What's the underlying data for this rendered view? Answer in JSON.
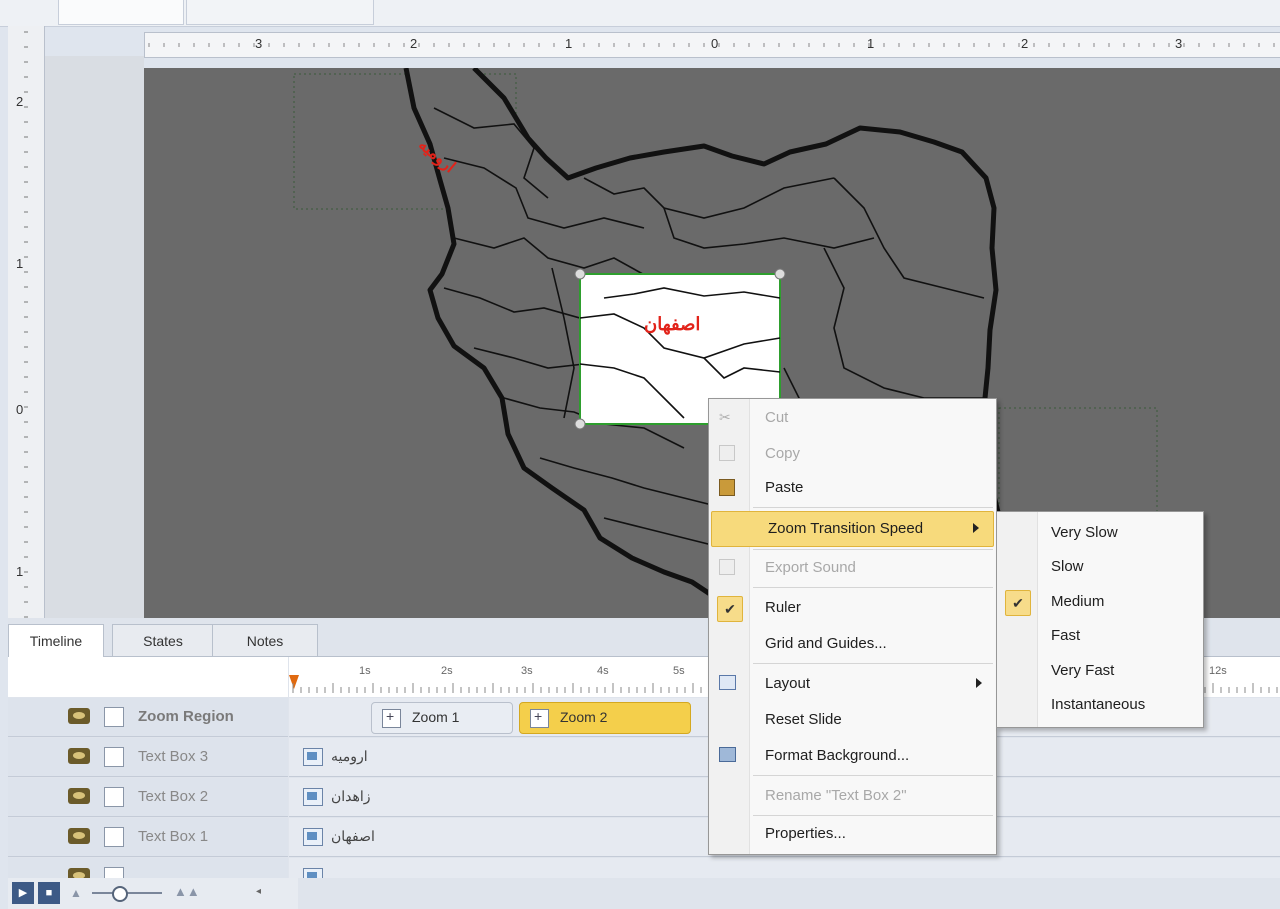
{
  "rulers": {
    "horizontal_labels": [
      "3",
      "2",
      "1",
      "0",
      "1",
      "2",
      "3"
    ],
    "vertical_labels": [
      "2",
      "1",
      "0",
      "1"
    ]
  },
  "canvas": {
    "label_urmia": "ارومیه",
    "label_isfahan": "اصفهان",
    "map_fill_color": "#6a6a6a",
    "selection_color": "#2e9e2e",
    "label_color": "#e2231a"
  },
  "tabs": [
    {
      "label": "Timeline",
      "active": true
    },
    {
      "label": "States",
      "active": false
    },
    {
      "label": "Notes",
      "active": false
    }
  ],
  "timeline": {
    "ticks": [
      "1s",
      "2s",
      "3s",
      "4s",
      "5s",
      "12s"
    ],
    "tracks": [
      {
        "name": "Zoom Region",
        "bold": true
      },
      {
        "name": "Text Box 3",
        "clip": "ارومیه"
      },
      {
        "name": "Text Box 2",
        "clip": "زاهدان"
      },
      {
        "name": "Text Box 1",
        "clip": "اصفهان"
      }
    ],
    "zoom_clips": [
      {
        "label": "Zoom 1",
        "selected": false
      },
      {
        "label": "Zoom 2",
        "selected": true
      }
    ]
  },
  "context_menu": {
    "items": [
      {
        "label": "Cut",
        "disabled": true,
        "icon": "scissors-icon"
      },
      {
        "label": "Copy",
        "disabled": true,
        "icon": "copy-icon"
      },
      {
        "label": "Paste",
        "disabled": false,
        "icon": "paste-icon"
      },
      {
        "label": "Zoom Transition Speed",
        "disabled": false,
        "submenu": true,
        "highlighted": true
      },
      {
        "label": "Export Sound",
        "disabled": true,
        "icon": "export-sound-icon"
      },
      {
        "label": "Ruler",
        "disabled": false,
        "checked": true
      },
      {
        "label": "Grid and Guides...",
        "disabled": false
      },
      {
        "label": "Layout",
        "disabled": false,
        "submenu": true,
        "icon": "layout-icon"
      },
      {
        "label": "Reset Slide",
        "disabled": false
      },
      {
        "label": "Format Background...",
        "disabled": false,
        "icon": "format-background-icon"
      },
      {
        "label": "Rename \"Text Box 2\"",
        "disabled": true
      },
      {
        "label": "Properties...",
        "disabled": false
      }
    ]
  },
  "speed_submenu": {
    "items": [
      {
        "label": "Very Slow",
        "checked": false
      },
      {
        "label": "Slow",
        "checked": false
      },
      {
        "label": "Medium",
        "checked": true
      },
      {
        "label": "Fast",
        "checked": false
      },
      {
        "label": "Very Fast",
        "checked": false
      },
      {
        "label": "Instantaneous",
        "checked": false
      }
    ]
  }
}
